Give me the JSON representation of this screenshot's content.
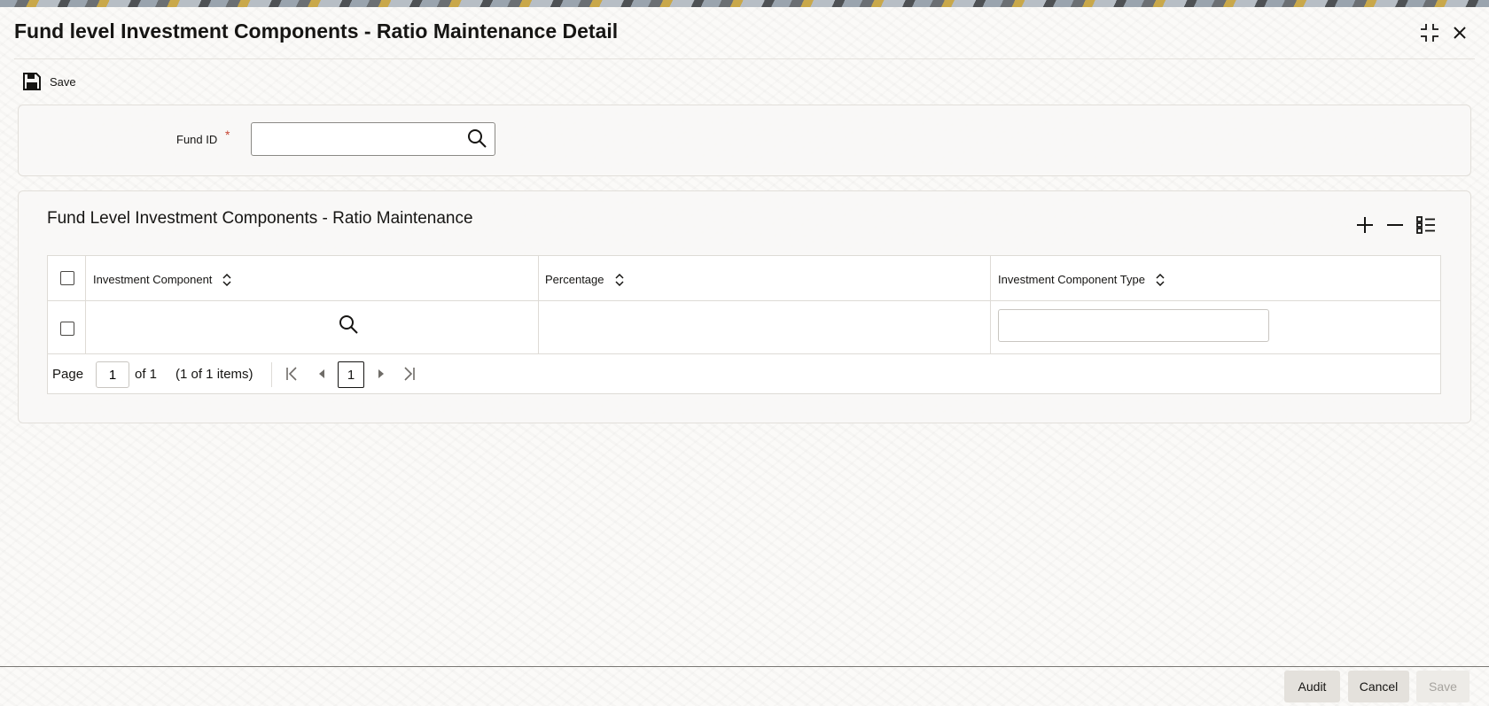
{
  "window": {
    "title": "Fund level Investment Components - Ratio Maintenance Detail"
  },
  "toolbar": {
    "save_label": "Save"
  },
  "form": {
    "fund_id_label": "Fund ID",
    "fund_id_required_mark": "*",
    "fund_id_value": ""
  },
  "section": {
    "title": "Fund Level Investment Components - Ratio Maintenance"
  },
  "table": {
    "columns": [
      "Investment Component",
      "Percentage",
      "Investment Component Type"
    ],
    "rows": [
      {
        "investment_component": "",
        "percentage": "",
        "investment_component_type": ""
      }
    ]
  },
  "pager": {
    "page_label": "Page",
    "current_page": "1",
    "of_label": "of 1",
    "items_label": "(1 of 1 items)",
    "page_button": "1"
  },
  "footer": {
    "audit_label": "Audit",
    "cancel_label": "Cancel",
    "save_label": "Save"
  },
  "colors": {
    "required": "#c74634",
    "text": "#161513",
    "button_bg": "#e4e1dc",
    "disabled_text": "#a6a39e"
  }
}
